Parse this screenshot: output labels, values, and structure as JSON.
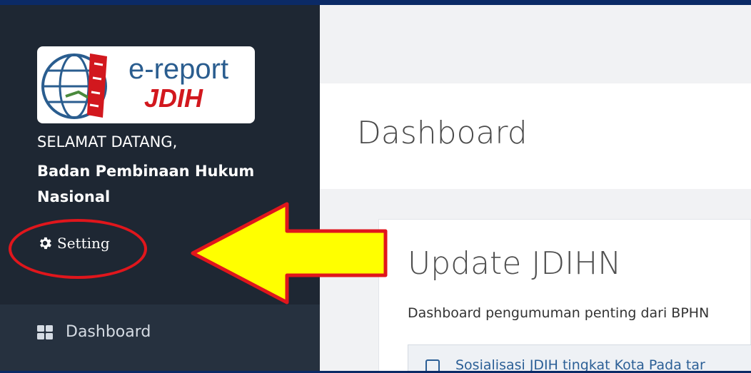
{
  "sidebar": {
    "logo": {
      "line1": "e-report",
      "line2": "JDIH"
    },
    "welcome": "SELAMAT DATANG,",
    "user_name": "Badan Pembinaan Hukum Nasional",
    "setting_label": "Setting",
    "nav": [
      {
        "label": "Dashboard",
        "icon": "grid-icon"
      }
    ]
  },
  "main": {
    "page_title": "Dashboard",
    "card": {
      "title": "Update JDIHN",
      "subtitle": "Dashboard pengumuman penting dari BPHN",
      "items": [
        {
          "text": "Sosialisasi JDIH tingkat Kota Pada tar"
        }
      ]
    }
  },
  "annotation": {
    "ellipse_color": "#e0161c",
    "arrow_fill": "#ffff00",
    "arrow_stroke": "#e0161c"
  }
}
